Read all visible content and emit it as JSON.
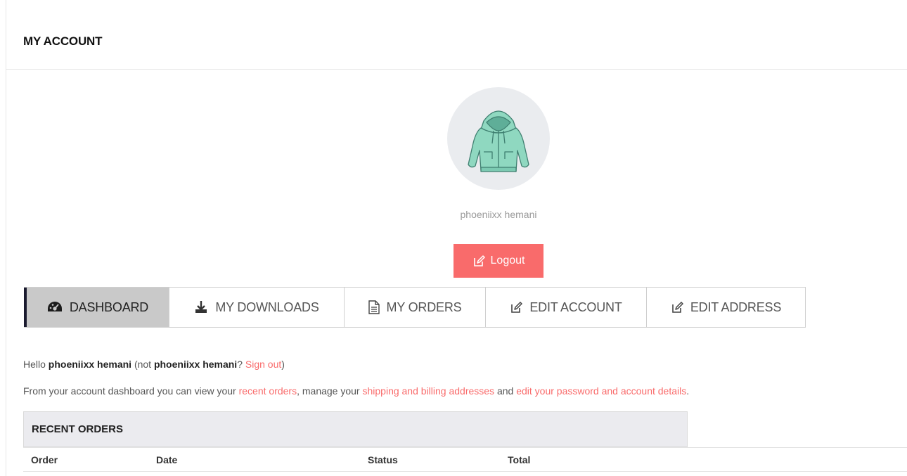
{
  "header": {
    "title": "MY ACCOUNT"
  },
  "profile": {
    "name": "phoeniixx hemani",
    "logout_label": "Logout"
  },
  "tabs": [
    {
      "label": "DASHBOARD",
      "icon": "dashboard-icon",
      "active": true
    },
    {
      "label": "MY DOWNLOADS",
      "icon": "download-icon"
    },
    {
      "label": "MY ORDERS",
      "icon": "file-icon"
    },
    {
      "label": "EDIT ACCOUNT",
      "icon": "edit-icon"
    },
    {
      "label": "EDIT ADDRESS",
      "icon": "edit-icon"
    }
  ],
  "greeting": {
    "hello": "Hello",
    "name": "phoeniixx hemani",
    "not_prefix": "(not",
    "not_name": "phoeniixx hemani",
    "question": "?",
    "signout": "Sign out",
    "close_paren": ")"
  },
  "dashboard_text": {
    "part1": "From your account dashboard you can view your",
    "link1": "recent orders",
    "part2": ", manage your",
    "link2": "shipping and billing addresses",
    "part3": "and",
    "link3": "edit your password and account details",
    "end": "."
  },
  "recent_orders": {
    "title": "RECENT ORDERS",
    "columns": [
      "Order",
      "Date",
      "Status",
      "Total"
    ]
  },
  "colors": {
    "accent": "#f96b6b",
    "active_tab_bg": "#c9c9c9",
    "active_tab_border": "#1b1b2f"
  }
}
